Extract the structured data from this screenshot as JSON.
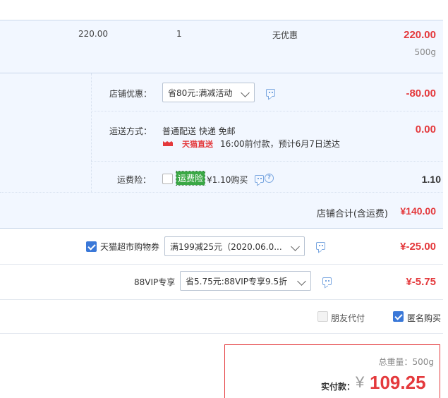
{
  "item": {
    "unit_price": "220.00",
    "quantity": "1",
    "discount": "无优惠",
    "subtotal": "220.00",
    "weight": "500g"
  },
  "shop": {
    "promo_label": "店铺优惠：",
    "promo_select": "省80元:满减活动",
    "promo_amount": "-80.00",
    "shipping_label": "运送方式：",
    "shipping_text": "普通配送 快递 免邮",
    "shipping_badge": "天猫直送",
    "shipping_eta": "16:00前付款，预计6月7日送达",
    "shipping_amount": "0.00",
    "insurance_label": "运费险：",
    "insurance_tag": "运费险",
    "insurance_price": "¥1.10购买",
    "insurance_amount": "1.10",
    "total_label": "店铺合计(含运费)",
    "total_amount": "¥140.00"
  },
  "coupon": {
    "checked": true,
    "label": "天猫超市购物券",
    "select": "满199减25元（2020.06.0...",
    "amount": "¥-25.00"
  },
  "vip": {
    "label": "88VIP专享",
    "select": "省5.75元:88VIP专享9.5折",
    "amount": "¥-5.75"
  },
  "options": {
    "friend_pay": "朋友代付",
    "anonymous": "匿名购买"
  },
  "summary": {
    "weight_label": "总重量：",
    "weight_value": "500g",
    "pay_label": "实付款：",
    "currency": "¥",
    "pay_amount": "109.25"
  },
  "colors": {
    "price_red": "#e4393c",
    "accent_blue": "#3a78d8",
    "light_bg": "#f2f7ff",
    "insurance_green": "#3aa845"
  }
}
